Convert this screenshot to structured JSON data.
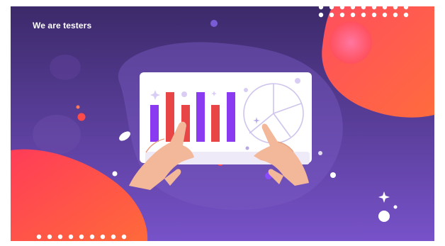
{
  "brand": {
    "logo_text": "We are testers"
  },
  "colors": {
    "background_top": "#3c2a6a",
    "background_bottom": "#7752c9",
    "blob_red": "#f0404e",
    "blob_orange": "#ff6b3d",
    "bar_purple": "#8a3bf2",
    "bar_red": "#e84646",
    "board": "#ffffff",
    "skin": "#f3b89a"
  },
  "icons": [
    "bar-chart-board-illustration",
    "pie-chart-illustration",
    "hand-pointer-illustration",
    "sparkle-icon",
    "decorative-dots-pattern"
  ]
}
